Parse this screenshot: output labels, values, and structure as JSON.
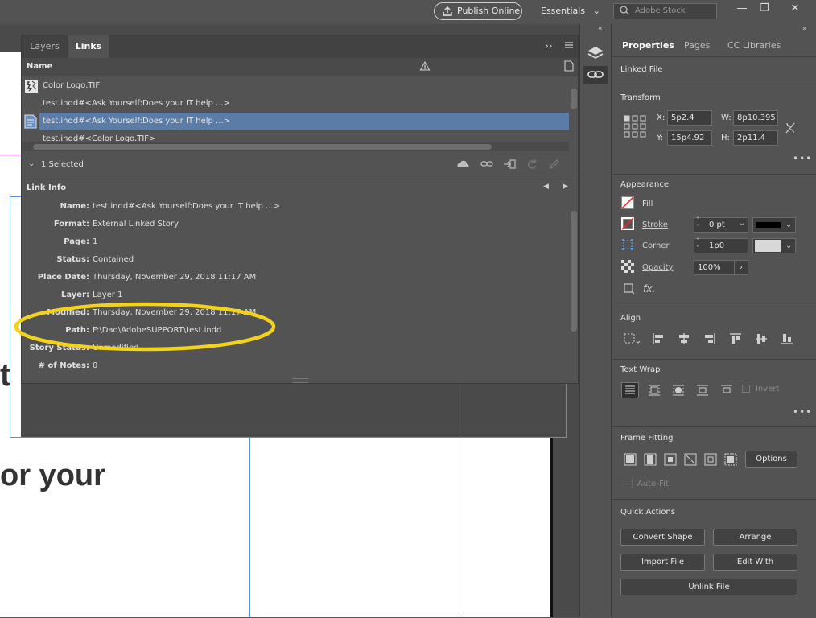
{
  "topbar": {
    "publish_label": "Publish Online",
    "workspace_label": "Essentials",
    "search_placeholder": "Adobe Stock"
  },
  "canvas": {
    "text_t": "t",
    "text_or_your": "or your"
  },
  "links_panel": {
    "tabs": [
      {
        "label": "Layers"
      },
      {
        "label": "Links"
      }
    ],
    "column_name": "Name",
    "rows": [
      {
        "label": "Color Logo.TIF"
      },
      {
        "label": "test.indd#<Ask Yourself:Does your IT help ...>"
      },
      {
        "label": "test.indd#<Ask Yourself:Does your IT help ...>"
      },
      {
        "label": "test.indd#<Color Logo.TIF>"
      }
    ],
    "selection_status": "1 Selected",
    "link_info_title": "Link Info",
    "info": [
      {
        "label": "Name:",
        "value": "test.indd#<Ask Yourself:Does your IT help ...>"
      },
      {
        "label": "Format:",
        "value": "External Linked Story"
      },
      {
        "label": "Page:",
        "value": "1"
      },
      {
        "label": "Status:",
        "value": "Contained"
      },
      {
        "label": "Place Date:",
        "value": "Thursday, November 29, 2018 11:17 AM"
      },
      {
        "label": "Layer:",
        "value": "Layer 1"
      },
      {
        "label": "Modified:",
        "value": "Thursday, November 29, 2018 11:17 AM"
      },
      {
        "label": "Path:",
        "value": "F:\\Dad\\AdobeSUPPORT\\test.indd"
      },
      {
        "label": "Story Status:",
        "value": "Unmodified"
      },
      {
        "label": "# of Notes:",
        "value": "0"
      }
    ],
    "highlight_color": "#f2d21b",
    "selected_row_color": "#5b7ca6"
  },
  "properties": {
    "tabs": [
      {
        "label": "Properties"
      },
      {
        "label": "Pages"
      },
      {
        "label": "CC Libraries"
      }
    ],
    "object_type": "Linked File",
    "transform": {
      "title": "Transform",
      "x_label": "X:",
      "x": "5p2.4",
      "y_label": "Y:",
      "y": "15p4.92",
      "w_label": "W:",
      "w": "8p10.395",
      "h_label": "H:",
      "h": "2p11.4"
    },
    "appearance": {
      "title": "Appearance",
      "fill_label": "Fill",
      "stroke_label": "Stroke",
      "stroke_value": "0 pt",
      "corner_label": "Corner",
      "corner_value": "1p0",
      "opacity_label": "Opacity",
      "opacity_value": "100%",
      "fx_label": "fx."
    },
    "align_title": "Align",
    "text_wrap": {
      "title": "Text Wrap",
      "invert_label": "Invert"
    },
    "frame_fitting": {
      "title": "Frame Fitting",
      "options_label": "Options",
      "autofit_label": "Auto-Fit"
    },
    "quick_actions": {
      "title": "Quick Actions",
      "convert_shape": "Convert Shape",
      "arrange": "Arrange",
      "import_file": "Import File",
      "edit_with": "Edit With",
      "unlink_file": "Unlink File"
    }
  }
}
